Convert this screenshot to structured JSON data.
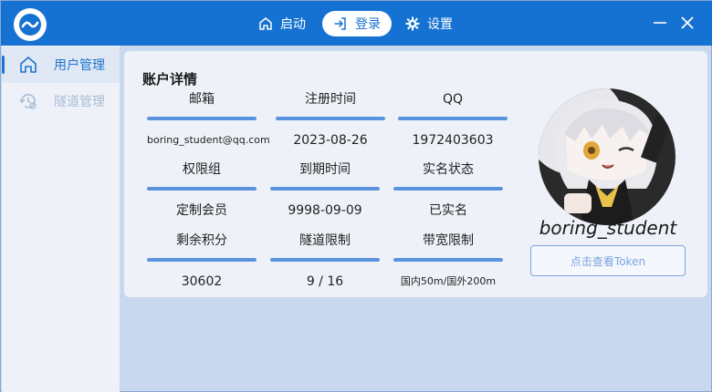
{
  "titlebar": {
    "nav": [
      {
        "label": "启动",
        "icon": "home-icon"
      },
      {
        "label": "登录",
        "icon": "login-icon"
      },
      {
        "label": "设置",
        "icon": "gear-icon"
      }
    ],
    "controls": {
      "minimize_icon": "minimize-icon",
      "close_icon": "close-icon"
    }
  },
  "sidebar": {
    "items": [
      {
        "label": "用户管理",
        "icon": "home-outline-icon",
        "state": "active"
      },
      {
        "label": "隧道管理",
        "icon": "history-settings-icon",
        "state": "disabled"
      }
    ]
  },
  "account": {
    "title": "账户详情",
    "fields": [
      {
        "label": "邮箱",
        "value": "boring_student@qq.com"
      },
      {
        "label": "注册时间",
        "value": "2023-08-26"
      },
      {
        "label": "QQ",
        "value": "1972403603"
      },
      {
        "label": "权限组",
        "value": "定制会员"
      },
      {
        "label": "到期时间",
        "value": "9998-09-09"
      },
      {
        "label": "实名状态",
        "value": "已实名"
      },
      {
        "label": "剩余积分",
        "value": "30602"
      },
      {
        "label": "隧道限制",
        "value": "9 / 16"
      },
      {
        "label": "带宽限制",
        "value": "国内50m/国外200m"
      }
    ],
    "username": "boring_student",
    "token_button": "点击查看Token"
  },
  "colors": {
    "titlebar": "#1672d2",
    "accent": "#1e74d0",
    "divider": "#5a93dd",
    "background": "#c8d8ee",
    "card": "#eef2f8"
  }
}
